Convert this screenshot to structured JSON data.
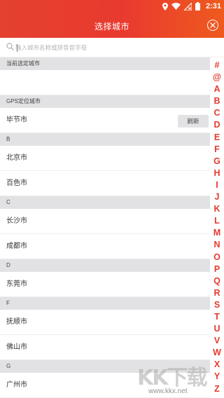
{
  "status_bar": {
    "time": "2:31",
    "icons": [
      "location-icon",
      "wifi-icon",
      "no-signal-icon",
      "battery-icon"
    ]
  },
  "header": {
    "title": "选择城市",
    "close_icon": "close-circle-icon",
    "accent_color": "#e93a2f"
  },
  "search": {
    "placeholder": "输入城市名称或拼音首字母",
    "value": ""
  },
  "sections": {
    "current": {
      "label": "当前选定城市"
    },
    "gps": {
      "label": "GPS定位城市",
      "city": "毕节市",
      "refresh_label": "刷新"
    },
    "b": {
      "label": "B",
      "cities": [
        "北京市",
        "百色市"
      ]
    },
    "c": {
      "label": "C",
      "cities": [
        "长沙市",
        "成都市"
      ]
    },
    "d": {
      "label": "D",
      "cities": [
        "东莞市"
      ]
    },
    "f": {
      "label": "F",
      "cities": [
        "抚顺市",
        "佛山市"
      ]
    },
    "g": {
      "label": "G",
      "cities": [
        "广州市"
      ]
    }
  },
  "index_bar": [
    "#",
    "@",
    "A",
    "B",
    "C",
    "D",
    "E",
    "F",
    "G",
    "H",
    "I",
    "J",
    "K",
    "L",
    "M",
    "N",
    "O",
    "P",
    "Q",
    "R",
    "S",
    "T",
    "U",
    "V",
    "W",
    "X",
    "Y",
    "Z"
  ],
  "watermark": {
    "text": "KK下载",
    "url": "www.kkx.net"
  }
}
